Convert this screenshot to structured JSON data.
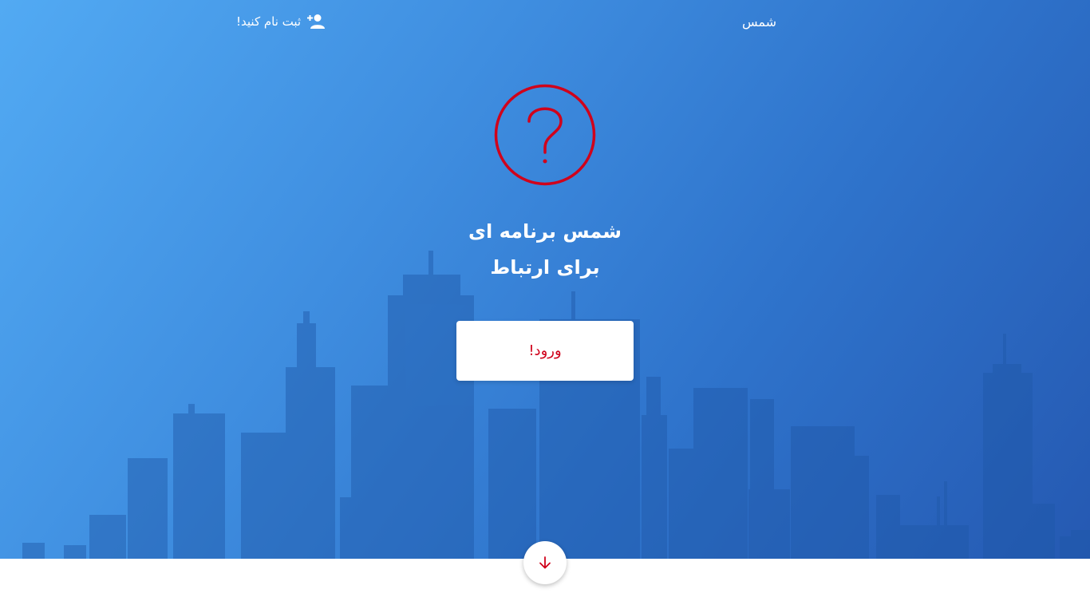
{
  "nav": {
    "brand": "شمس",
    "signup_label": "ثبت نام کنید!",
    "signup_icon": "user-plus-icon"
  },
  "hero": {
    "status_icon": "question-circle-icon",
    "headline_line1": "شمس برنامه ای",
    "headline_line2": "برای ارتباط",
    "login_label": "ورود!",
    "scroll_icon": "arrow-down-icon"
  },
  "colors": {
    "accent": "#d0021b",
    "gradient_start": "#52aaf3",
    "gradient_end": "#2559b2"
  }
}
